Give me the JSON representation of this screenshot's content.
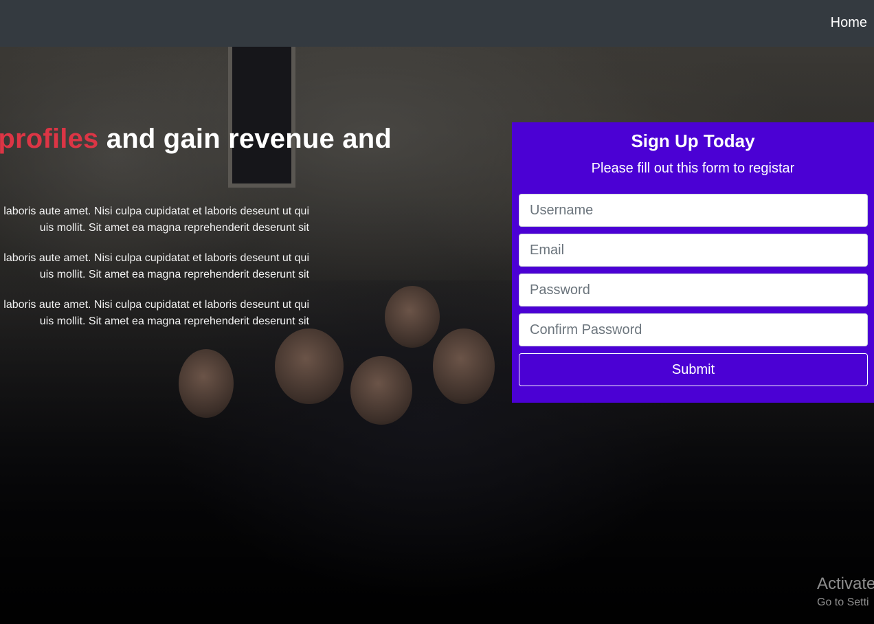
{
  "nav": {
    "home_label": "Home"
  },
  "hero": {
    "title_accent": "al profiles",
    "title_rest": " and gain revenue and",
    "paragraphs": [
      [
        "laboris aute amet. Nisi culpa cupidatat et laboris deseunt ut qui",
        "uis mollit. Sit amet ea magna reprehenderit deserunt sit"
      ],
      [
        "laboris aute amet. Nisi culpa cupidatat et laboris deseunt ut qui",
        "uis mollit. Sit amet ea magna reprehenderit deserunt sit"
      ],
      [
        "laboris aute amet. Nisi culpa cupidatat et laboris deseunt ut qui",
        "uis mollit. Sit amet ea magna reprehenderit deserunt sit"
      ]
    ]
  },
  "signup": {
    "title": "Sign Up Today",
    "subtitle": "Please fill out this form to registar",
    "username_placeholder": "Username",
    "email_placeholder": "Email",
    "password_placeholder": "Password",
    "confirm_placeholder": "Confirm Password",
    "submit_label": "Submit",
    "bg_color": "#4b01d4"
  },
  "overlay": {
    "activate_line1": "Activate",
    "activate_line2": "Go to Setti"
  },
  "colors": {
    "navbar": "#343a40",
    "accent": "#dc3545"
  }
}
